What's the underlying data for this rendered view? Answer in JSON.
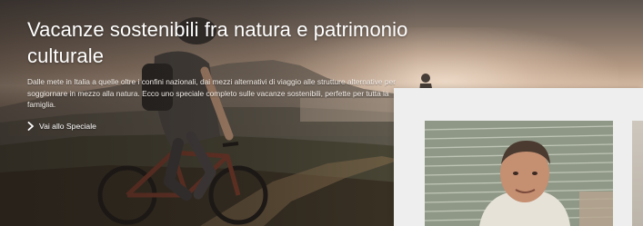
{
  "hero": {
    "title": "Vacanze sostenibili fra natura e patrimonio culturale",
    "description": "Dalle mete in Italia a quelle oltre i confini nazionali, dai mezzi alternativi di viaggio alle strutture alternative per soggiornare in mezzo alla natura. Ecco uno speciale completo sulle vacanze sostenibili, perfette per tutta la famiglia.",
    "link_label": "Vai allo Speciale",
    "link_icon": "chevron-right-icon"
  },
  "colors": {
    "text": "#ffffff",
    "panel_background": "#eeeeee"
  }
}
